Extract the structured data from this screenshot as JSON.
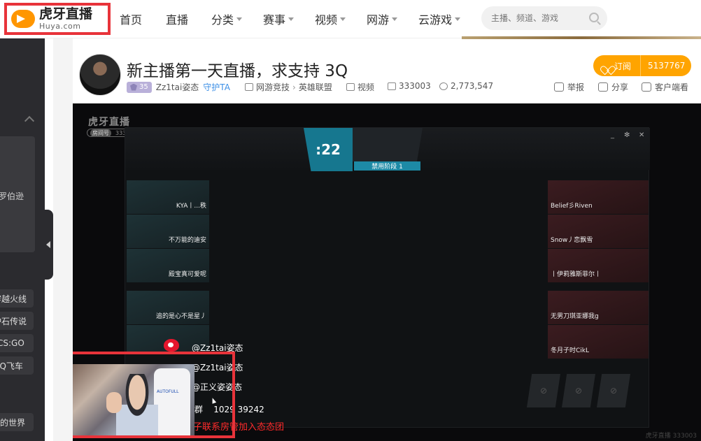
{
  "nav": {
    "logo_cn": "虎牙直播",
    "logo_en": "Huya.com",
    "items": [
      {
        "label": "首页",
        "caret": false
      },
      {
        "label": "直播",
        "caret": false
      },
      {
        "label": "分类",
        "caret": true
      },
      {
        "label": "赛事",
        "caret": true
      },
      {
        "label": "视频",
        "caret": true
      },
      {
        "label": "网游",
        "caret": true
      },
      {
        "label": "云游戏",
        "caret": true
      }
    ],
    "search_placeholder": "主播、频道、游戏"
  },
  "sidebar": {
    "partial_text_1": "罗伯逊",
    "chips": [
      "穿越火线",
      "炉石传说",
      "CS:GO",
      "QQ飞车"
    ],
    "partial_text_2": "我的世界"
  },
  "room": {
    "title": "新主播第一天直播，求支持 3Q",
    "level": "35",
    "streamer": "Zz1tai姿态",
    "guard": "守护TA",
    "category_parent": "网游竞技",
    "category_child": "英雄联盟",
    "video_label": "视频",
    "room_id": "333003",
    "followers": "2,773,547",
    "subscribe_label": "订阅",
    "subscribe_count": "5137767",
    "report_label": "举报",
    "share_label": "分享",
    "client_label": "客户端看"
  },
  "player": {
    "watermark": "虎牙直播",
    "watermark_room_tag": "房间号",
    "watermark_room_id": "333003",
    "timer": ":22",
    "phase": "禁用阶段 1",
    "blue_team": [
      "KYA丨...秩",
      "不万能的迪安",
      "殿宝真可爱呢",
      "",
      "追的是心不是星丿"
    ],
    "red_team": [
      "Belief彡Riven",
      "Snow丿恋飘雪",
      "丨伊莉雅斯菲尔丨",
      "",
      "无男刀琪亚娜我g",
      "冬月子时CikL"
    ],
    "social": [
      "@Zz1tai姿态",
      "@Zz1tai姿态",
      "@正义姿姿态"
    ],
    "qq_group_label": "群",
    "qq_group_number": "1029 39242",
    "red_notice": "子联系房管加入态态团",
    "chair_brand": "AUTOFULL",
    "bottom_right": "虎牙直播 333003"
  }
}
